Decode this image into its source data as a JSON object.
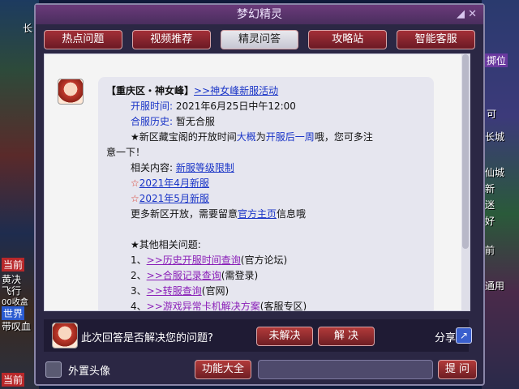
{
  "game_left": {
    "city": "长",
    "current_tag": "当前",
    "status_lines": [
      "黄决",
      "飞行",
      "00收盒"
    ],
    "world_tag": "世界",
    "world_text": "带叹血",
    "bottom_tag": "当前"
  },
  "game_right": {
    "tag1": "掷位",
    "lines": [
      "可",
      "长城",
      "仙城",
      "新",
      "迷",
      "好",
      "前",
      "通用"
    ]
  },
  "window": {
    "title": "梦幻精灵",
    "controls": "◢ ✕"
  },
  "tabs": [
    {
      "label": "热点问题"
    },
    {
      "label": "视频推荐"
    },
    {
      "label": "精灵问答"
    },
    {
      "label": "攻略站"
    },
    {
      "label": "智能客服"
    }
  ],
  "answer": {
    "header_prefix": "【重庆区・神女峰】",
    "header_link": ">>神女峰新服活动",
    "open_time_label": "开服时间:",
    "open_time_value": "2021年6月25日中午12:00",
    "merge_label": "合服历史:",
    "merge_value": "暂无合服",
    "note_pre": "★新区藏宝阁的开放时间",
    "note_big": "大概",
    "note_mid": "为",
    "note_hl": "开服后一周",
    "note_end": "哦，您可多注",
    "note_line2": "意一下！",
    "related_label": "相关内容:",
    "related_link": "新服等级限制",
    "apr_link": "2021年4月新服",
    "may_link": "2021年5月新服",
    "more_pre": "更多新区开放，需要留意",
    "more_link": "官方主页",
    "more_end": "信息哦",
    "other_title": "★其他相关问题:",
    "q1_num": "1、",
    "q1_link": ">>历史开服时间查询",
    "q1_note": "(官方论坛)",
    "q2_num": "2、",
    "q2_link": ">>合服记录查询",
    "q2_note": "(需登录)",
    "q3_num": "3、",
    "q3_link": ">>转服查询",
    "q3_note": "(官网)",
    "q4_num": "4、",
    "q4_link": ">>游戏异常卡机解决方案",
    "q4_note": "(客服专区)"
  },
  "feedback": {
    "question": "此次回答是否解决您的问题?",
    "unsolved": "未解决",
    "solved": "解 决",
    "share": "分享"
  },
  "bottom": {
    "external_avatar": "外置头像",
    "functions": "功能大全",
    "ask": "提 问"
  }
}
